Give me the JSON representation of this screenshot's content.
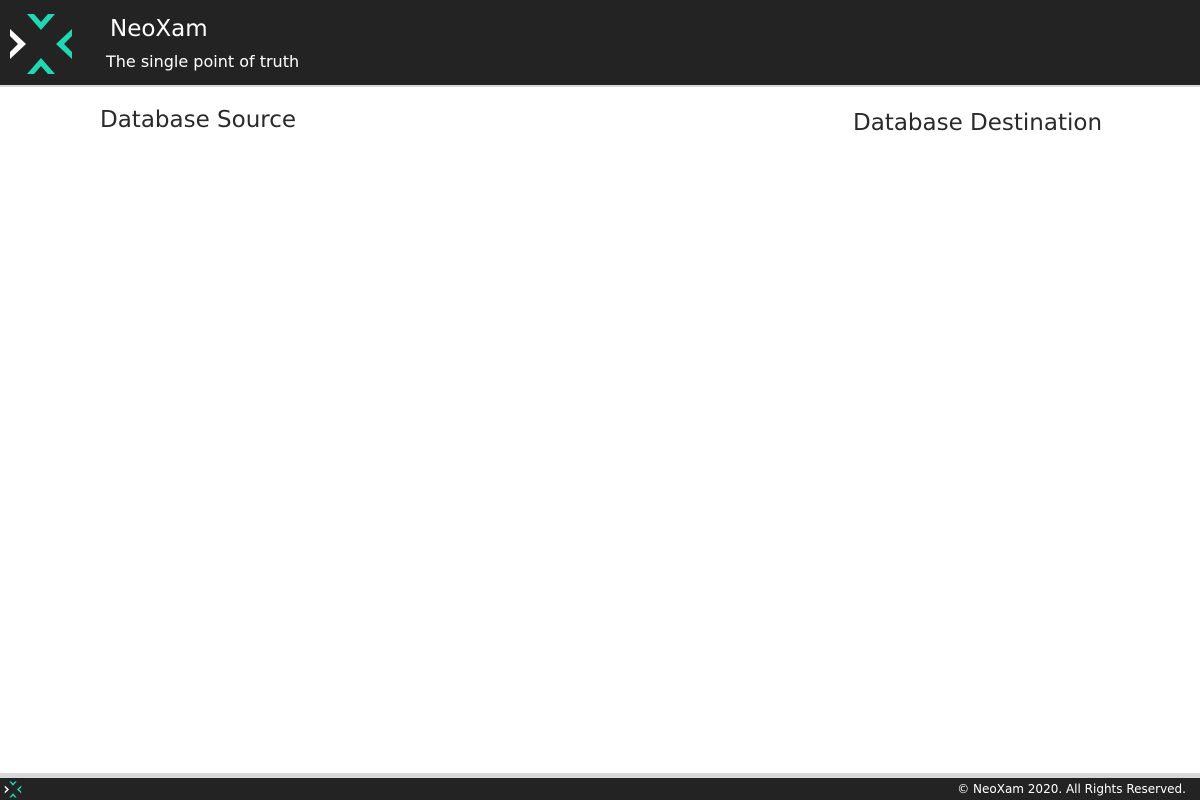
{
  "header": {
    "brand_title": "NeoXam",
    "tagline": "The single point of truth",
    "logo_icon": "neoxam-logo-icon"
  },
  "main": {
    "source_heading": "Database Source",
    "destination_heading": "Database Destination"
  },
  "footer": {
    "logo_icon": "neoxam-logo-icon",
    "copyright": "© NeoXam 2020. All Rights Reserved."
  },
  "colors": {
    "bar_background": "#232323",
    "accent_teal": "#1ed9b3",
    "logo_white": "#ffffff",
    "heading_text": "#2a2a2a",
    "separator": "#d9d9d9"
  }
}
